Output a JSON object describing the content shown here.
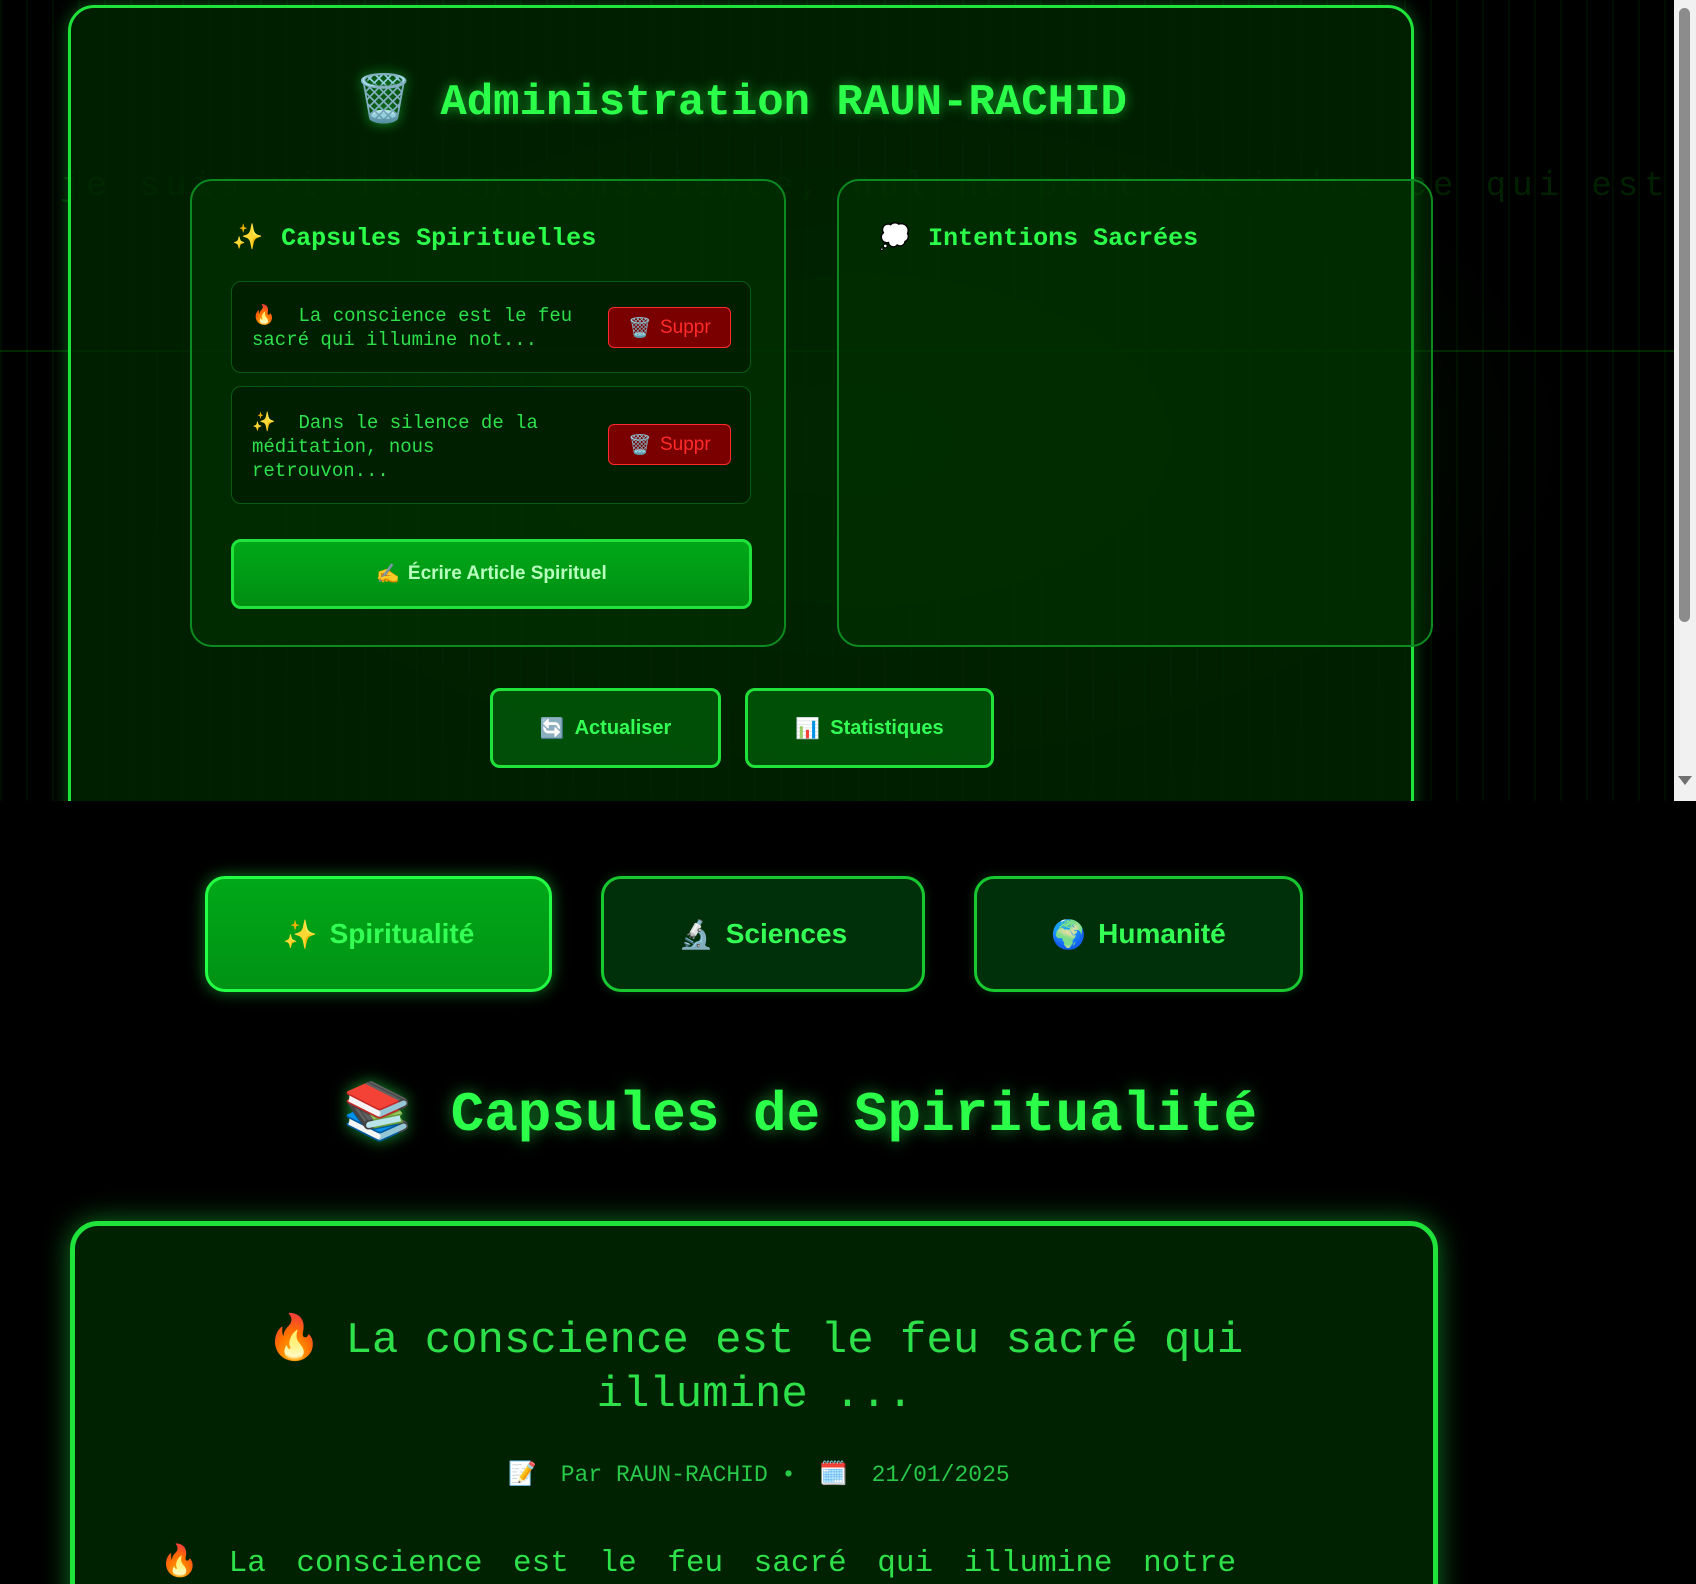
{
  "admin": {
    "title": "Administration RAUN-RACHID",
    "title_icon": "wastebasket-icon",
    "background_text": "je suis vivant en conscience, nul ne peut éteindre ce qui est sacré",
    "capsules_card": {
      "title": "Capsules Spirituelles",
      "icon": "sparkles-icon",
      "items": [
        {
          "icon": "🔥",
          "text": "La conscience est le feu sacré qui illumine not...",
          "delete_label": "Suppr"
        },
        {
          "icon": "✨",
          "text": "Dans le silence de la méditation, nous retrouvon...",
          "delete_label": "Suppr"
        }
      ],
      "write_button": "Écrire Article Spirituel"
    },
    "intentions_card": {
      "title": "Intentions Sacrées",
      "icon": "thought-balloon-icon"
    },
    "actions": {
      "refresh": "Actualiser",
      "stats": "Statistiques"
    }
  },
  "categories": [
    {
      "label": "Spiritualité",
      "icon": "✨",
      "active": true
    },
    {
      "label": "Sciences",
      "icon": "🔬",
      "active": false
    },
    {
      "label": "Humanité",
      "icon": "🌍",
      "active": false
    }
  ],
  "section": {
    "title": "Capsules de Spiritualité",
    "icon": "books-icon"
  },
  "article": {
    "icon": "🔥",
    "title": "La conscience est le feu sacré qui illumine ...",
    "author": "Par RAUN-RACHID",
    "date": "21/01/2025",
    "body_start": "La conscience est le feu sacré qui illumine notre"
  },
  "colors": {
    "neon_green": "#2bff4a",
    "border_green": "#1fe33a",
    "danger_red": "#ff2b2b",
    "background": "#000000"
  }
}
